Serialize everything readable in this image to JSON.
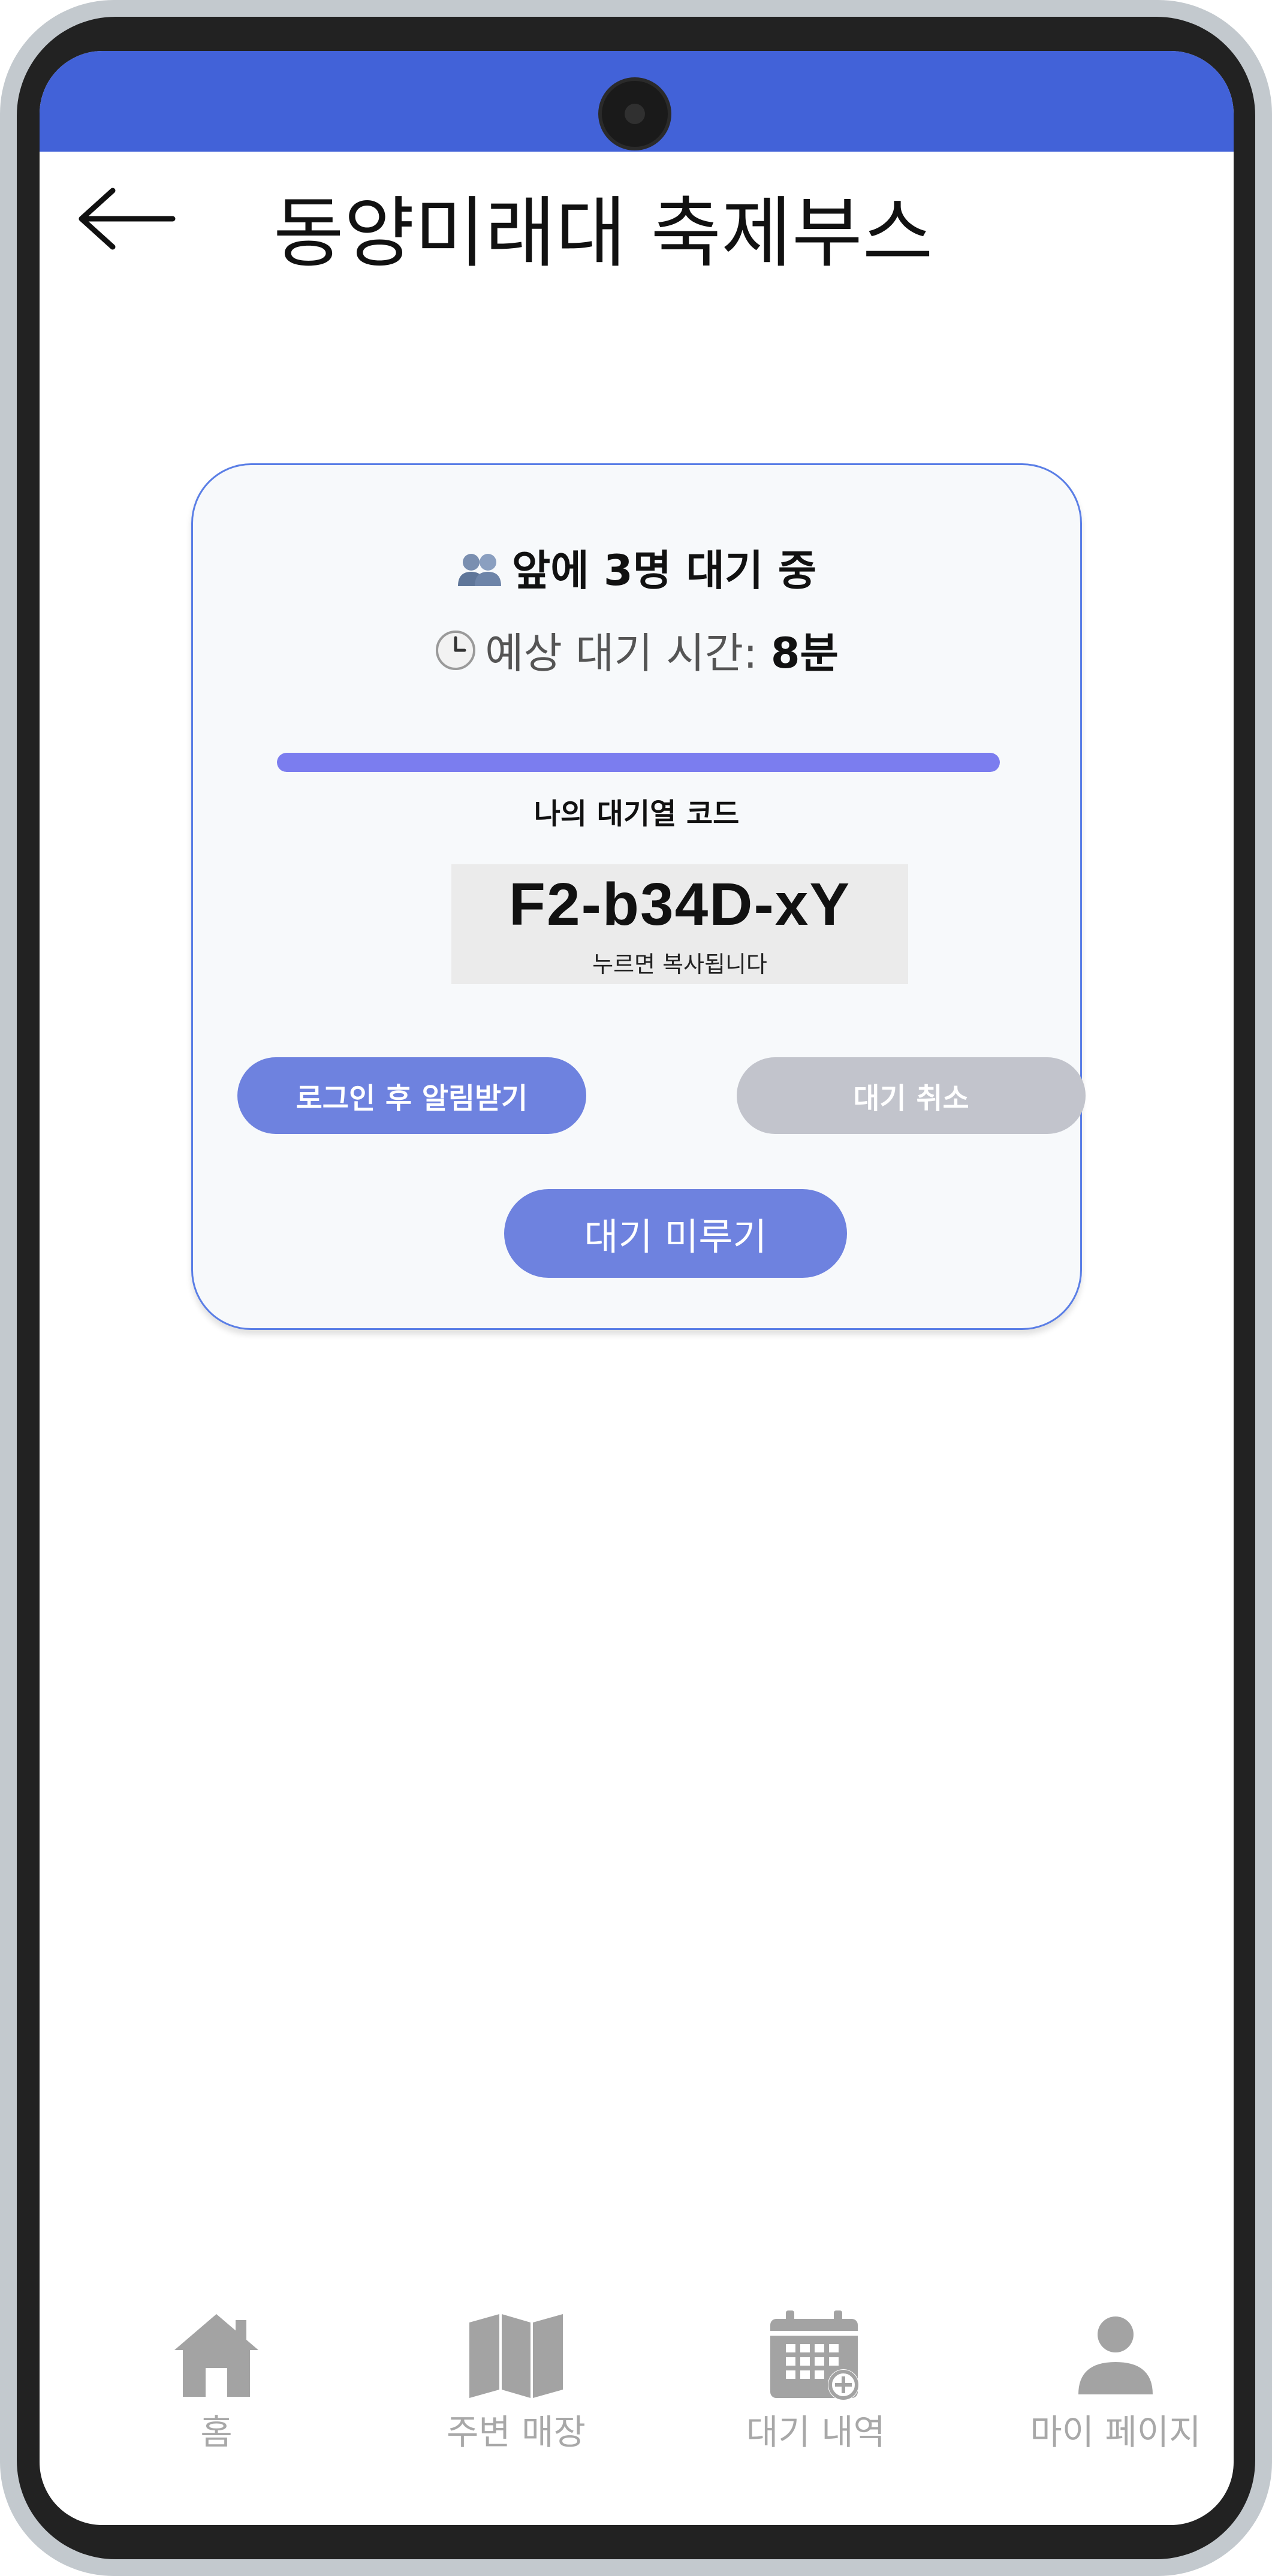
{
  "status_bar": {
    "color": "#4262d8"
  },
  "header": {
    "back_icon": "arrow-left-icon",
    "title": "동양미래대 축제부스"
  },
  "queue": {
    "ahead_icon": "people-icon",
    "ahead_text": "앞에 3명 대기 중",
    "wait_icon": "clock-icon",
    "wait_label": "예상 대기 시간: ",
    "wait_value": "8분",
    "progress": 1.0,
    "progress_color": "#7b7def",
    "code_label": "나의 대기열 코드",
    "code": "F2-b34D-xY",
    "code_hint": "누르면 복사됩니다"
  },
  "actions": {
    "notify_label": "로그인 후 알림받기",
    "cancel_label": "대기 취소",
    "postpone_label": "대기 미루기",
    "accent_color": "#6e82df",
    "disabled_color": "#c2c4cc"
  },
  "bottom_nav": {
    "items": [
      {
        "label": "홈",
        "icon": "home-icon"
      },
      {
        "label": "주변 매장",
        "icon": "map-icon"
      },
      {
        "label": "대기 내역",
        "icon": "calendar-add-icon"
      },
      {
        "label": "마이 페이지",
        "icon": "person-icon"
      }
    ]
  }
}
